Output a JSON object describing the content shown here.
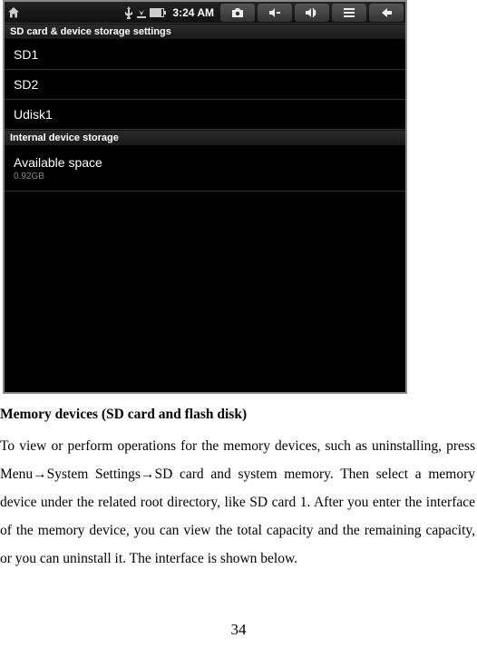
{
  "screenshot": {
    "status_bar": {
      "time": "3:24 AM"
    },
    "header1": "SD card & device storage settings",
    "items": [
      {
        "label": "SD1"
      },
      {
        "label": "SD2"
      },
      {
        "label": "Udisk1"
      }
    ],
    "header2": "Internal device storage",
    "available": {
      "label": "Available space",
      "value": "0.92GB"
    }
  },
  "doc": {
    "title": "Memory devices (SD card and flash disk)",
    "para": "To view or perform operations for the memory devices, such as uninstalling, press Menu→System Settings→SD card and system memory. Then select a memory device under the related root directory, like SD card 1. After you enter the interface of the memory device, you can view the total capacity and the remaining capacity, or you can uninstall it. The interface is shown below."
  },
  "page_number": "34"
}
